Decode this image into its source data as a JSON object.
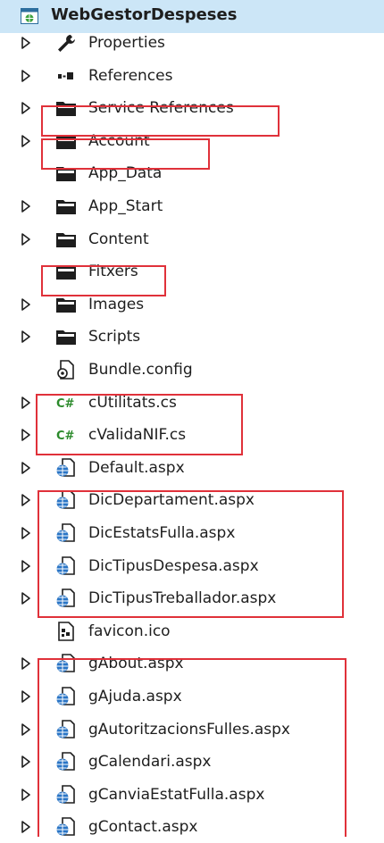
{
  "project": {
    "name": "WebGestorDespeses",
    "icon": "web-project-icon"
  },
  "items": [
    {
      "label": "Properties",
      "icon": "wrench-icon",
      "expandable": true
    },
    {
      "label": "References",
      "icon": "references-icon",
      "expandable": true
    },
    {
      "label": "Service References",
      "icon": "folder-icon",
      "expandable": true
    },
    {
      "label": "Account",
      "icon": "folder-icon",
      "expandable": true
    },
    {
      "label": "App_Data",
      "icon": "folder-icon",
      "expandable": false
    },
    {
      "label": "App_Start",
      "icon": "folder-icon",
      "expandable": true
    },
    {
      "label": "Content",
      "icon": "folder-icon",
      "expandable": true
    },
    {
      "label": "Fitxers",
      "icon": "folder-icon",
      "expandable": false
    },
    {
      "label": "Images",
      "icon": "folder-icon",
      "expandable": true
    },
    {
      "label": "Scripts",
      "icon": "folder-icon",
      "expandable": true
    },
    {
      "label": "Bundle.config",
      "icon": "config-file-icon",
      "expandable": false
    },
    {
      "label": "cUtilitats.cs",
      "icon": "csharp-file-icon",
      "expandable": true
    },
    {
      "label": "cValidaNIF.cs",
      "icon": "csharp-file-icon",
      "expandable": true
    },
    {
      "label": "Default.aspx",
      "icon": "aspx-file-icon",
      "expandable": true
    },
    {
      "label": "DicDepartament.aspx",
      "icon": "aspx-file-icon",
      "expandable": true
    },
    {
      "label": "DicEstatsFulla.aspx",
      "icon": "aspx-file-icon",
      "expandable": true
    },
    {
      "label": "DicTipusDespesa.aspx",
      "icon": "aspx-file-icon",
      "expandable": true
    },
    {
      "label": "DicTipusTreballador.aspx",
      "icon": "aspx-file-icon",
      "expandable": true
    },
    {
      "label": "favicon.ico",
      "icon": "ico-file-icon",
      "expandable": false
    },
    {
      "label": "gAbout.aspx",
      "icon": "aspx-file-icon",
      "expandable": true
    },
    {
      "label": "gAjuda.aspx",
      "icon": "aspx-file-icon",
      "expandable": true
    },
    {
      "label": "gAutoritzacionsFulles.aspx",
      "icon": "aspx-file-icon",
      "expandable": true
    },
    {
      "label": "gCalendari.aspx",
      "icon": "aspx-file-icon",
      "expandable": true
    },
    {
      "label": "gCanviaEstatFulla.aspx",
      "icon": "aspx-file-icon",
      "expandable": true
    },
    {
      "label": "gContact.aspx",
      "icon": "aspx-file-icon",
      "expandable": true
    }
  ],
  "colors": {
    "selection": "#cce6f7",
    "highlight_border": "#e0313a"
  }
}
